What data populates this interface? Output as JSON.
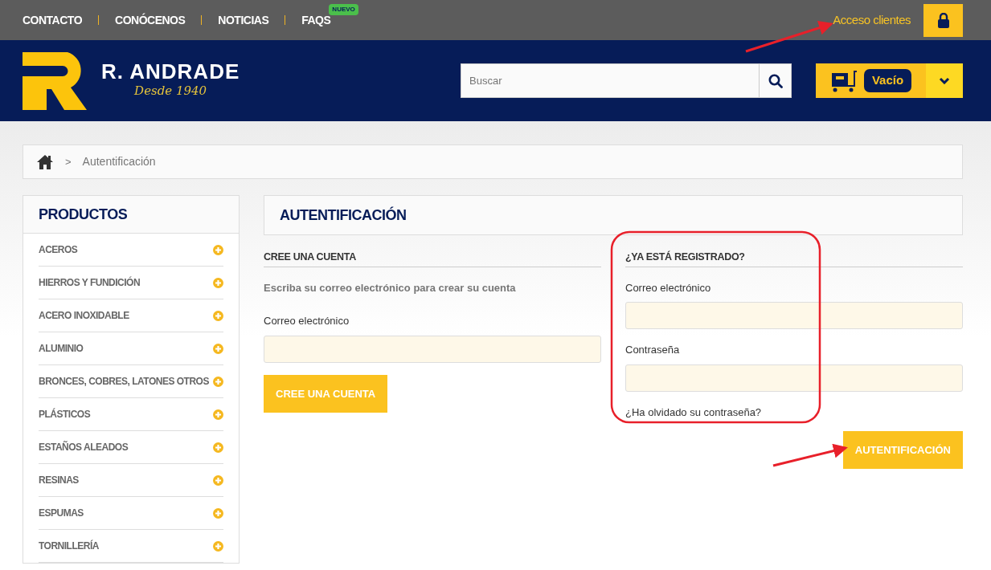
{
  "top_nav": [
    {
      "label": "CONTACTO"
    },
    {
      "label": "CONÓCENOS"
    },
    {
      "label": "NOTICIAS"
    },
    {
      "label": "FAQS",
      "badge": "NUEVO"
    }
  ],
  "client_access": {
    "label": "Acceso clientes"
  },
  "logo": {
    "name": "R. ANDRADE",
    "tagline": "Desde 1940"
  },
  "search": {
    "placeholder": "Buscar"
  },
  "cart": {
    "label": "Vacío"
  },
  "breadcrumb": [
    {
      "separator": ">",
      "label": "Autentificación"
    }
  ],
  "sidebar": {
    "title": "PRODUCTOS",
    "items": [
      {
        "label": "ACEROS"
      },
      {
        "label": "HIERROS Y FUNDICIÓN"
      },
      {
        "label": "ACERO INOXIDABLE"
      },
      {
        "label": "ALUMINIO"
      },
      {
        "label": "BRONCES, COBRES, LATONES OTROS"
      },
      {
        "label": "PLÁSTICOS"
      },
      {
        "label": "ESTAÑOS ALEADOS"
      },
      {
        "label": "RESINAS"
      },
      {
        "label": "ESPUMAS"
      },
      {
        "label": "TORNILLERÍA"
      }
    ]
  },
  "page_title": "AUTENTIFICACIÓN",
  "create_account": {
    "title": "CREE UNA CUENTA",
    "hint": "Escriba su correo electrónico para crear su cuenta",
    "email_label": "Correo electrónico",
    "button": "CREE UNA CUENTA"
  },
  "login": {
    "title": "¿YA ESTÁ REGISTRADO?",
    "email_label": "Correo electrónico",
    "password_label": "Contraseña",
    "forgot_link": "¿Ha olvidado su contraseña?",
    "button": "AUTENTIFICACIÓN"
  }
}
